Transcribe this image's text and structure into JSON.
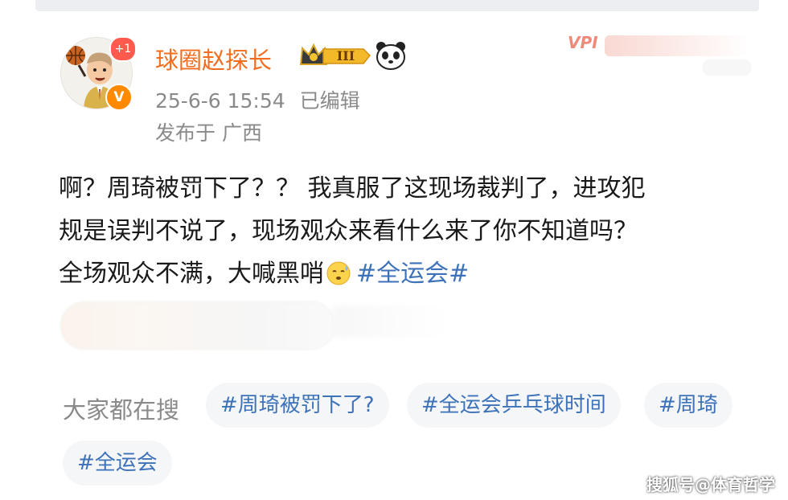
{
  "post": {
    "author": "球圈赵探长",
    "vip_level_label": "III",
    "timestamp": "25-6-6 15:54",
    "edited_label": "已编辑",
    "location": "发布于 广西",
    "follower_badge": "+1",
    "verified_badge": "V",
    "text_line1": "啊？周琦被罚下了？？ 我真服了这现场裁判了，进攻犯",
    "text_line2": "规是误判不说了，现场观众来看什么来了你不知道吗？",
    "text_line3": "全场观众不满，大喊黑哨",
    "hashtag": "#全运会#"
  },
  "vip_watermark": "VPI",
  "search": {
    "label": "大家都在搜",
    "tags": [
      "#周琦被罚下了?",
      "#全运会乒乓球时间",
      "#周琦",
      "#全运会"
    ]
  },
  "watermark": "搜狐号@体育哲学",
  "colors": {
    "username": "#f26d1f",
    "hashtag": "#3d72b8",
    "meta": "#8a8a8a",
    "tag_bg": "#f4f6f8",
    "badge_red": "#ff5a4e",
    "verified_orange": "#ff8a00"
  },
  "icons": [
    "crown-icon",
    "panda-icon",
    "sweat-emoji-icon",
    "basketball-icon"
  ]
}
